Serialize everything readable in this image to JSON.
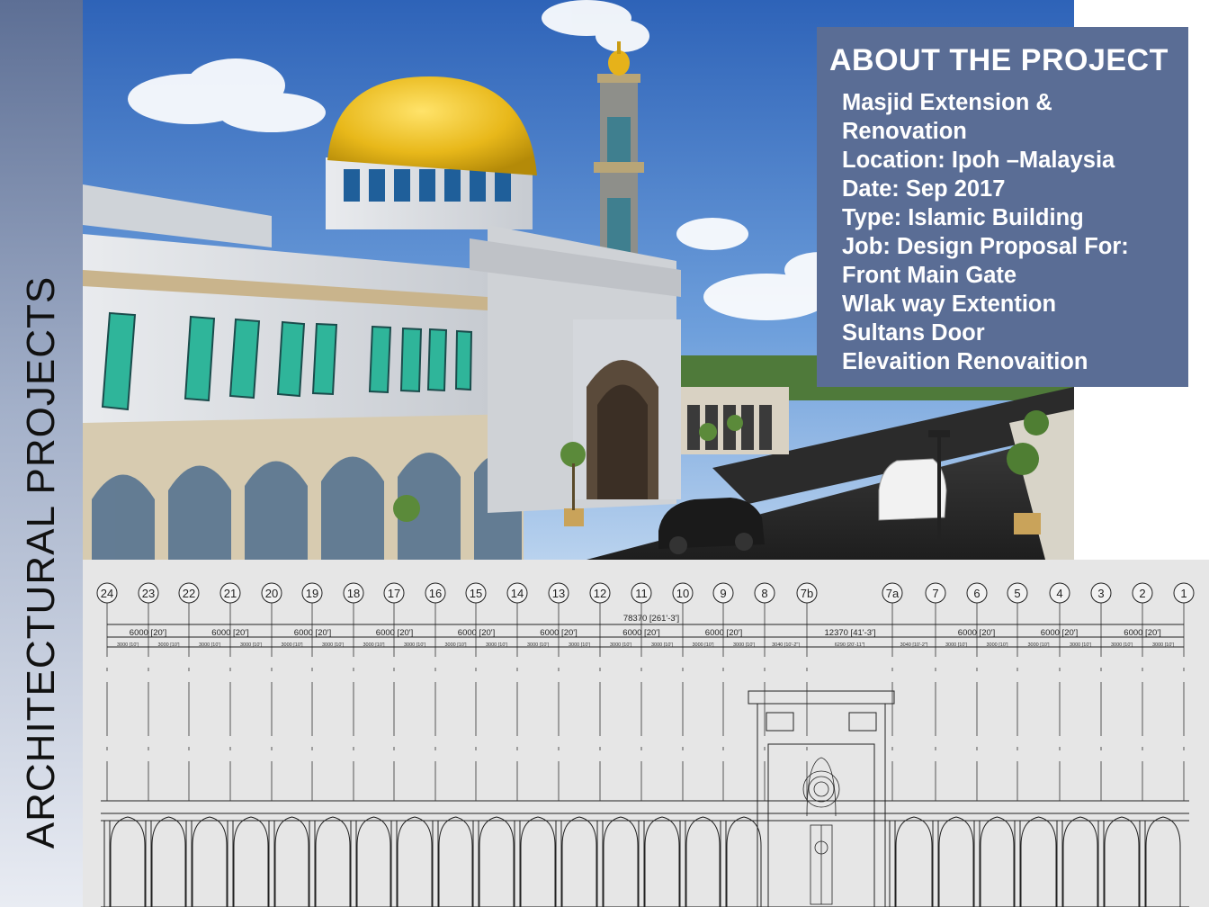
{
  "side_title": "ARCHITECTURAL PROJECTS",
  "about": {
    "title": "ABOUT THE PROJECT",
    "lines": [
      "Masjid Extension &",
      "Renovation",
      "Location: Ipoh –Malaysia",
      "Date: Sep 2017",
      "Type: Islamic Building",
      "Job: Design Proposal For:",
      "Front Main Gate",
      "Wlak way Extention",
      "Sultans Door",
      "Elevaition Renovaition"
    ]
  },
  "elevation": {
    "grid_labels": [
      "24",
      "23",
      "22",
      "21",
      "20",
      "19",
      "18",
      "17",
      "16",
      "15",
      "14",
      "13",
      "12",
      "11",
      "10",
      "9",
      "8",
      "7b",
      "7a",
      "7",
      "6",
      "5",
      "4",
      "3",
      "2",
      "1"
    ],
    "overall_dimension": "78370 [261'-3']",
    "bay_dimensions": [
      {
        "label": "6000 [20']",
        "from": "24",
        "to": "22"
      },
      {
        "label": "6000 [20']",
        "from": "22",
        "to": "20"
      },
      {
        "label": "6000 [20']",
        "from": "20",
        "to": "18"
      },
      {
        "label": "6000 [20']",
        "from": "18",
        "to": "16"
      },
      {
        "label": "6000 [20']",
        "from": "16",
        "to": "14"
      },
      {
        "label": "6000 [20']",
        "from": "14",
        "to": "12"
      },
      {
        "label": "6000 [20']",
        "from": "12",
        "to": "10"
      },
      {
        "label": "6000 [20']",
        "from": "10",
        "to": "8"
      },
      {
        "label": "12370 [41'-3']",
        "from": "8",
        "to": "7"
      },
      {
        "label": "6000 [20']",
        "from": "7",
        "to": "5"
      },
      {
        "label": "6000 [20']",
        "from": "5",
        "to": "3"
      },
      {
        "label": "6000 [20']",
        "from": "3",
        "to": "1"
      }
    ],
    "sub_dimensions": [
      "3000 [10']",
      "3000 [10']",
      "3000 [10']",
      "3000 [10']",
      "3000 [10']",
      "3000 [10']",
      "3000 [10']",
      "3000 [10']",
      "3000 [10']",
      "3000 [10']",
      "3000 [10']",
      "3000 [10']",
      "3000 [10']",
      "3000 [10']",
      "3000 [10']",
      "3000 [10']",
      "3040 [10'-2\"]",
      "6290 [20'-11\"]",
      "3040 [10'-2\"]",
      "3000 [10']",
      "3000 [10']",
      "3000 [10']",
      "3000 [10']",
      "3000 [10']",
      "3000 [10']"
    ]
  }
}
